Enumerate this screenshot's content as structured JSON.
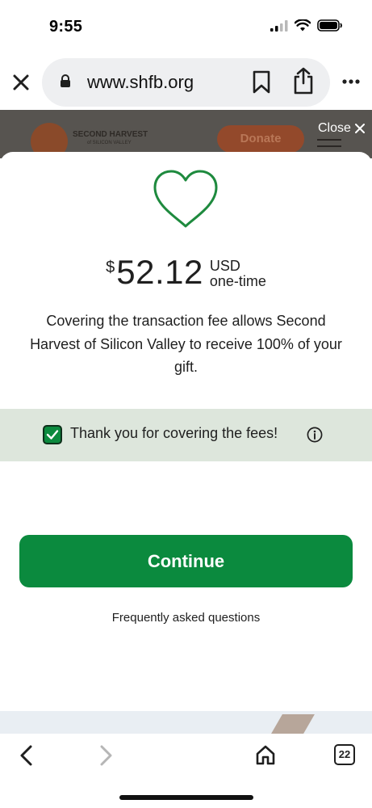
{
  "status_bar": {
    "time": "9:55"
  },
  "browser": {
    "url": "www.shfb.org",
    "icons": [
      "close-icon",
      "lock-icon",
      "bookmark-icon",
      "share-icon",
      "more-icon"
    ]
  },
  "site_header": {
    "logo_title": "SECOND HARVEST",
    "logo_subtitle": "of SILICON VALLEY",
    "donate_label": "Donate",
    "close_label": "Close"
  },
  "modal": {
    "currency_symbol": "$",
    "amount": "52.12",
    "currency_code": "USD",
    "frequency": "one-time",
    "description": "Covering the transaction fee allows Second Harvest of Silicon Valley to receive 100% of your gift.",
    "fee_checkbox_label": "Thank you for covering the fees!",
    "fee_checked": true,
    "continue_label": "Continue",
    "faq_label": "Frequently asked questions"
  },
  "bottom_bar": {
    "tab_count": "22"
  },
  "colors": {
    "accent_green": "#0b8a3e",
    "fee_band": "#dde6dc",
    "heart_stroke": "#1e8a3e"
  }
}
